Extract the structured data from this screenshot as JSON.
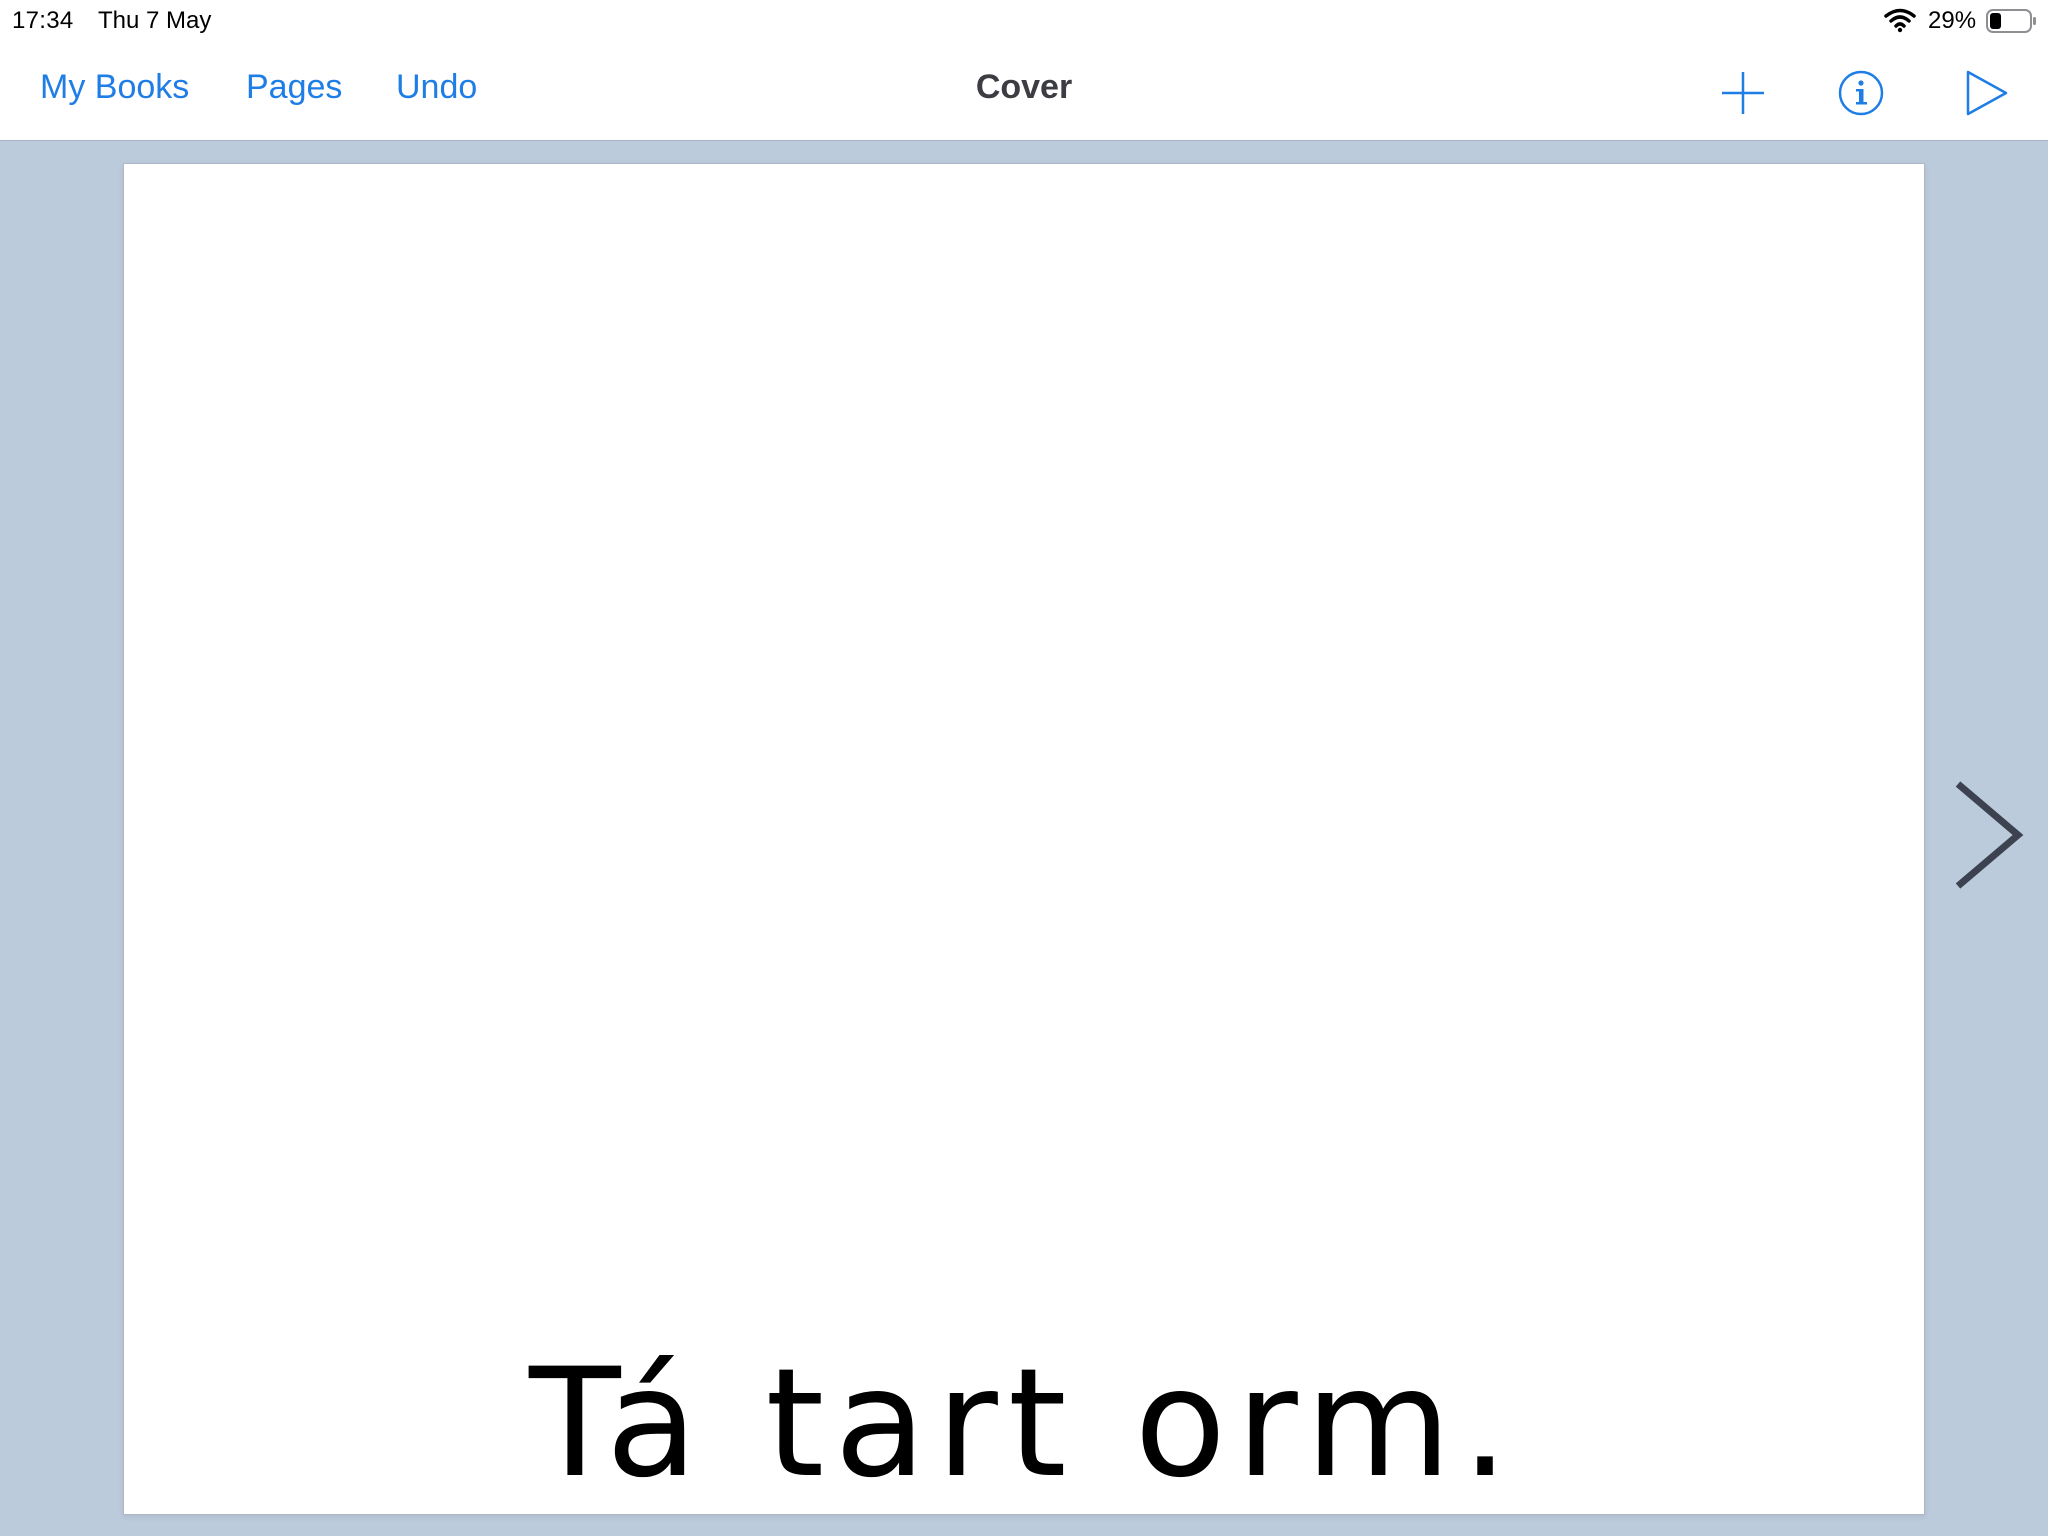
{
  "status_bar": {
    "time": "17:34",
    "date": "Thu 7 May",
    "battery_percent": "29%",
    "battery_level": 0.29
  },
  "nav_bar": {
    "left_buttons": [
      "My Books",
      "Pages",
      "Undo"
    ],
    "title": "Cover",
    "accent_color": "#1f7de6"
  },
  "page": {
    "text": "Tá tart orm."
  },
  "icons": {
    "add": "plus-icon",
    "info": "info-icon",
    "play": "play-icon",
    "next": "chevron-right-icon",
    "wifi": "wifi-icon",
    "battery": "battery-icon"
  }
}
